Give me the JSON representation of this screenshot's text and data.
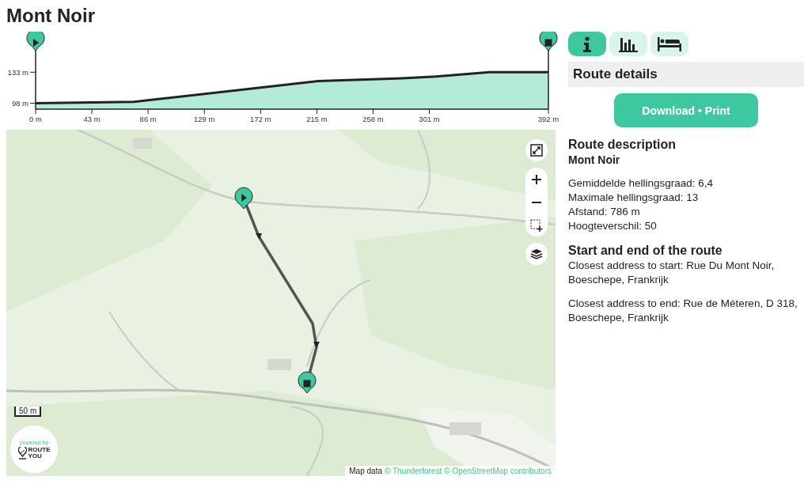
{
  "title": "Mont Noir",
  "elevation": {
    "chart_data": {
      "type": "area",
      "x": [
        0,
        75,
        216,
        280,
        306,
        347,
        392
      ],
      "series": [
        {
          "color": "#b3ead9",
          "values": [
            98,
            99.6,
            123,
            126.2,
            128.1,
            133,
            133
          ]
        }
      ],
      "xlim": [
        0,
        392
      ],
      "ylim": [
        91.4,
        160.9
      ],
      "xticks": [
        {
          "value": 0,
          "label": "0 m"
        },
        {
          "value": 43,
          "label": "43 m"
        },
        {
          "value": 86,
          "label": "86 m"
        },
        {
          "value": 129,
          "label": "129 m"
        },
        {
          "value": 172,
          "label": "172 m"
        },
        {
          "value": 215,
          "label": "215 m"
        },
        {
          "value": 258,
          "label": "258 m"
        },
        {
          "value": 301,
          "label": "301 m"
        },
        {
          "value": 392,
          "label": "392 m"
        }
      ],
      "yticks": [
        {
          "value": 98,
          "label": "98 m"
        },
        {
          "value": 133,
          "label": "133 m"
        }
      ]
    }
  },
  "map": {
    "scale": "50 m",
    "logo": {
      "tagline": "powered by",
      "line1": "ROUTE",
      "line2": "YOU"
    },
    "attribution": {
      "prefix": "Map data",
      "links": [
        "© Thunderforest",
        "© OpenStreetMap contributors"
      ]
    }
  },
  "tabs": [
    {
      "kind": "info",
      "selected": true
    },
    {
      "kind": "chart",
      "selected": false
    },
    {
      "kind": "bed",
      "selected": false
    }
  ],
  "panel": {
    "heading": "Route details",
    "button": "Download • Print",
    "description_title": "Route description",
    "route_name": "Mont Noir",
    "stats": [
      "Gemiddelde hellingsgraad: 6,4",
      "Maximale hellingsgraad: 13",
      "Afstand: 786 m",
      "Hoogteverschil: 50"
    ],
    "section_title": "Start and end of the route",
    "addresses": [
      "Closest address to start: Rue Du Mont Noir, Boeschepe, Frankrijk",
      "Closest address to end: Rue de Méteren, D 318, Boeschepe, Frankrijk"
    ]
  }
}
